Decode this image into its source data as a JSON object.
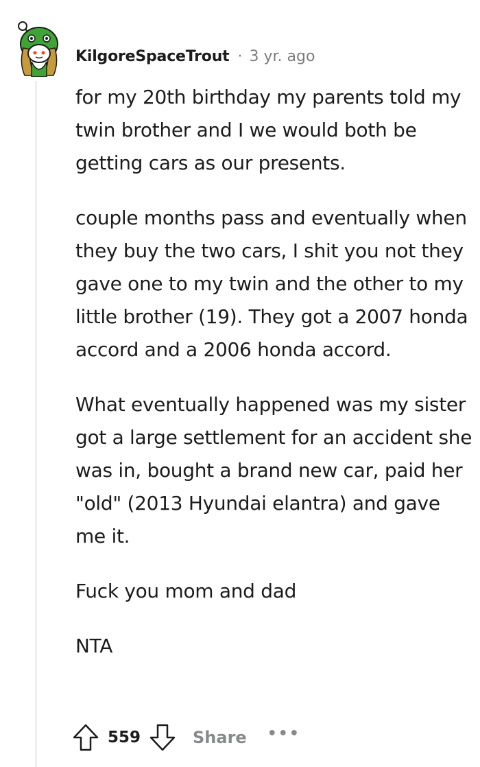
{
  "comment": {
    "username": "KilgoreSpaceTrout",
    "separator": "·",
    "timestamp": "3 yr. ago",
    "avatar_icon": "snoo-avatar-icon",
    "paragraphs": [
      "for my 20th birthday my parents told my twin brother and I we would both be getting cars as our presents.",
      "couple months pass and eventually when they buy the two cars, I shit you not they gave one to my twin and the other to my little brother (19). They got a 2007 honda accord and a 2006 honda accord.",
      "What eventually happened was my sister got a large settlement for an accident she was in, bought a brand new car, paid her \"old\" (2013 Hyundai elantra) and gave me it.",
      "Fuck you mom and dad",
      "NTA"
    ],
    "score": "559",
    "share_label": "Share",
    "more_label": "•••",
    "icons": {
      "upvote": "upvote-arrow-icon",
      "downvote": "downvote-arrow-icon"
    },
    "colors": {
      "text": "#1c1c1c",
      "meta": "#7c7c7c",
      "action": "#878a8c",
      "thread_line": "#edeff1"
    }
  }
}
